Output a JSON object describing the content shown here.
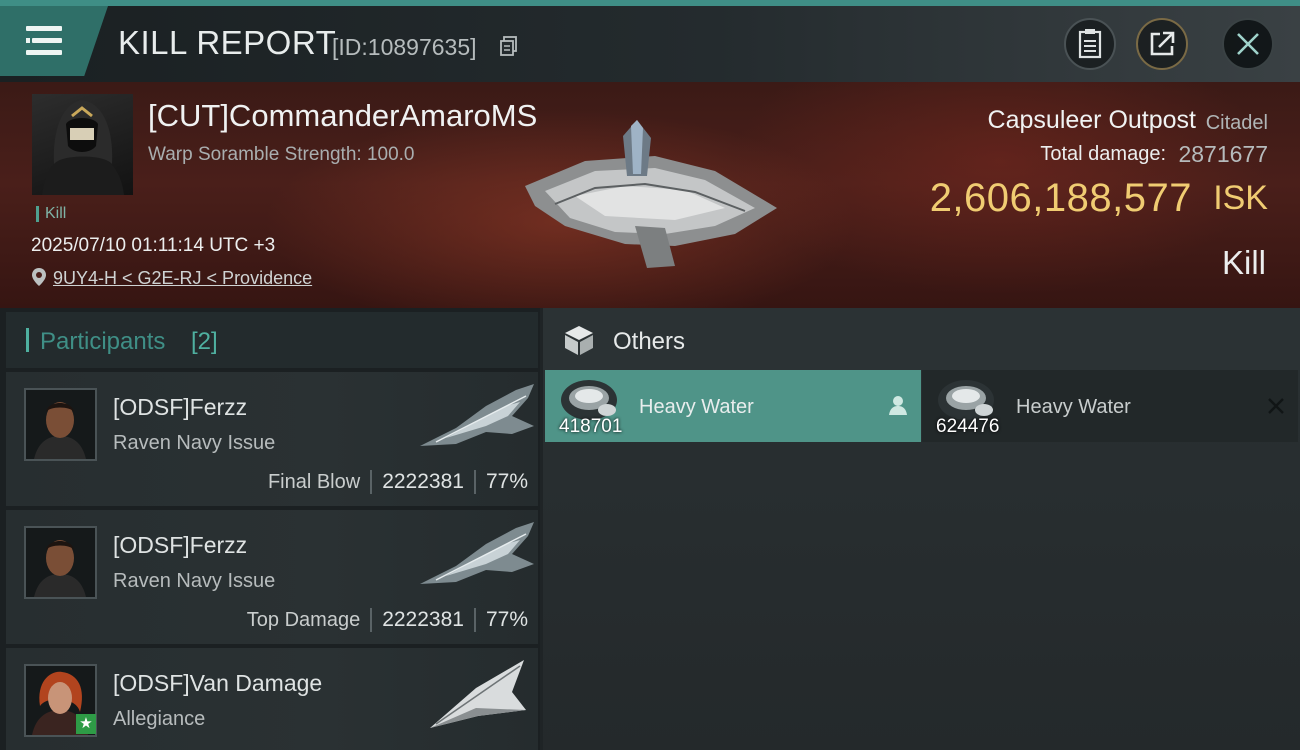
{
  "header": {
    "title": "KILL REPORT",
    "report_id": "[ID:10897635]"
  },
  "victim": {
    "name": "[CUT]CommanderAmaroMS",
    "scramble": "Warp Soramble Strength: 100.0",
    "kill_tag": "Kill",
    "timestamp": "2025/07/10 01:11:14 UTC +3",
    "location": "9UY4-H < G2E-RJ < Providence"
  },
  "target": {
    "name": "Capsuleer Outpost",
    "type": "Citadel",
    "total_damage_label": "Total damage:",
    "total_damage_value": "2871677",
    "isk_value": "2,606,188,577",
    "isk_unit": "ISK",
    "result": "Kill"
  },
  "participants": {
    "title": "Participants",
    "count": "[2]",
    "items": [
      {
        "name": "[ODSF]Ferzz",
        "ship": "Raven Navy Issue",
        "role": "Final Blow",
        "damage": "2222381",
        "percent": "77%"
      },
      {
        "name": "[ODSF]Ferzz",
        "ship": "Raven Navy Issue",
        "role": "Top Damage",
        "damage": "2222381",
        "percent": "77%"
      },
      {
        "name": "[ODSF]Van Damage",
        "ship": "Allegiance"
      }
    ]
  },
  "others": {
    "title": "Others",
    "items": [
      {
        "name": "Heavy Water",
        "qty": "418701"
      },
      {
        "name": "Heavy Water",
        "qty": "624476"
      }
    ]
  },
  "colors": {
    "accent": "#4fb0a0",
    "isk": "#f0cc72",
    "selected_item": "#4f9488"
  },
  "icons": [
    "menu-icon",
    "copy-icon",
    "notes-icon",
    "share-icon",
    "close-icon",
    "location-pin-icon",
    "cube-icon",
    "person-icon",
    "x-icon",
    "star-icon"
  ]
}
